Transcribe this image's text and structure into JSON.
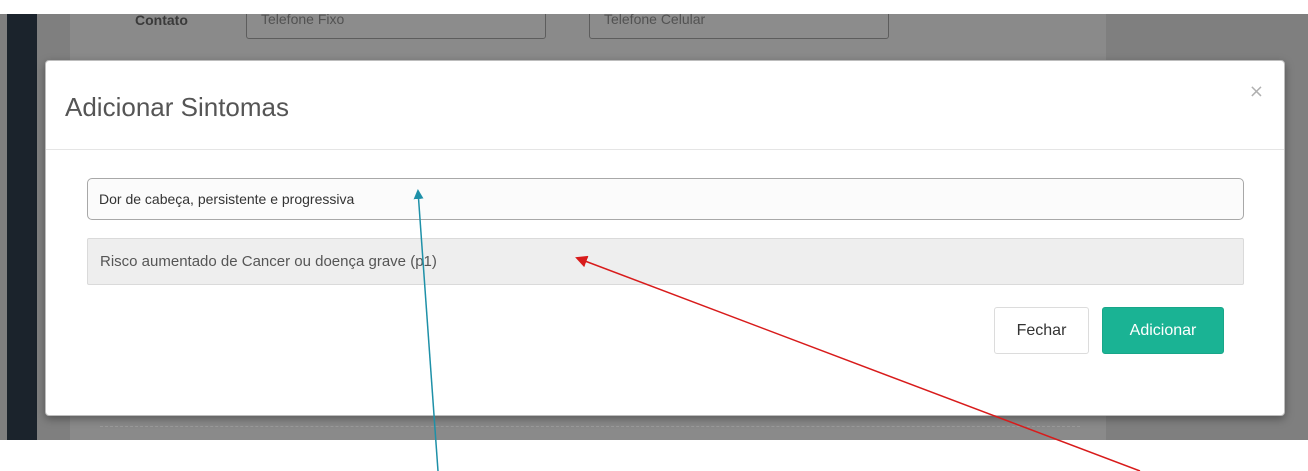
{
  "background": {
    "contact_label": "Contato",
    "phone_fixed_placeholder": "Telefone Fixo",
    "phone_mobile_placeholder": "Telefone Celular"
  },
  "modal": {
    "title": "Adicionar Sintomas",
    "close_symbol": "×",
    "symptom_value": "Dor de cabeça, persistente e progressiva",
    "risk_text": "Risco aumentado de Cancer ou doença grave (p1)",
    "close_label": "Fechar",
    "add_label": "Adicionar"
  },
  "colors": {
    "accent": "#1ab394",
    "arrow_teal": "#1e90a8",
    "arrow_red": "#d81b1b"
  }
}
